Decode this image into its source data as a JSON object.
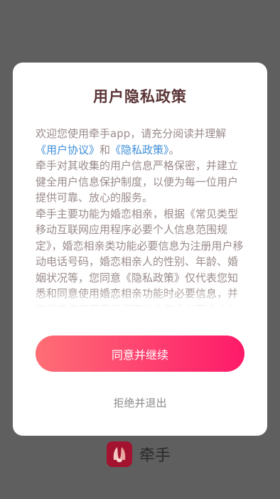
{
  "dialog": {
    "title": "用户隐私政策",
    "intro_before": "欢迎您使用牵手app，请充分阅读并理解",
    "user_agreement_link": "《用户协议》",
    "intro_and": "和",
    "privacy_policy_link": "《隐私政策》",
    "intro_after": "。",
    "para2": "牵手对其收集的用户信息严格保密，并建立健全用户信息保护制度，以便为每一位用户提供可靠、放心的服务。",
    "para3": "牵手主要功能为婚恋相亲，根据《常见类型移动互联网应用程序必要个人信息范围规定》，婚恋相亲类功能必要信息为注册用户移动电话号码，婚恋相亲人的性别、年龄、婚姻状况等，您同意《隐私政策》仅代表您知悉和同意使用婚恋相亲功能时必要信息，并不代表您已同意我们可以收集非必要个人信息。",
    "agree_button": "同意并继续",
    "reject_button": "拒绝并退出"
  },
  "brand": {
    "name": "牵手",
    "logo_icon": "holding-hands-logo-icon"
  },
  "colors": {
    "accent_start": "#fe6e75",
    "accent_end": "#fe1a6a",
    "link": "#3f8fd9",
    "logo_bg": "#a3122e"
  }
}
